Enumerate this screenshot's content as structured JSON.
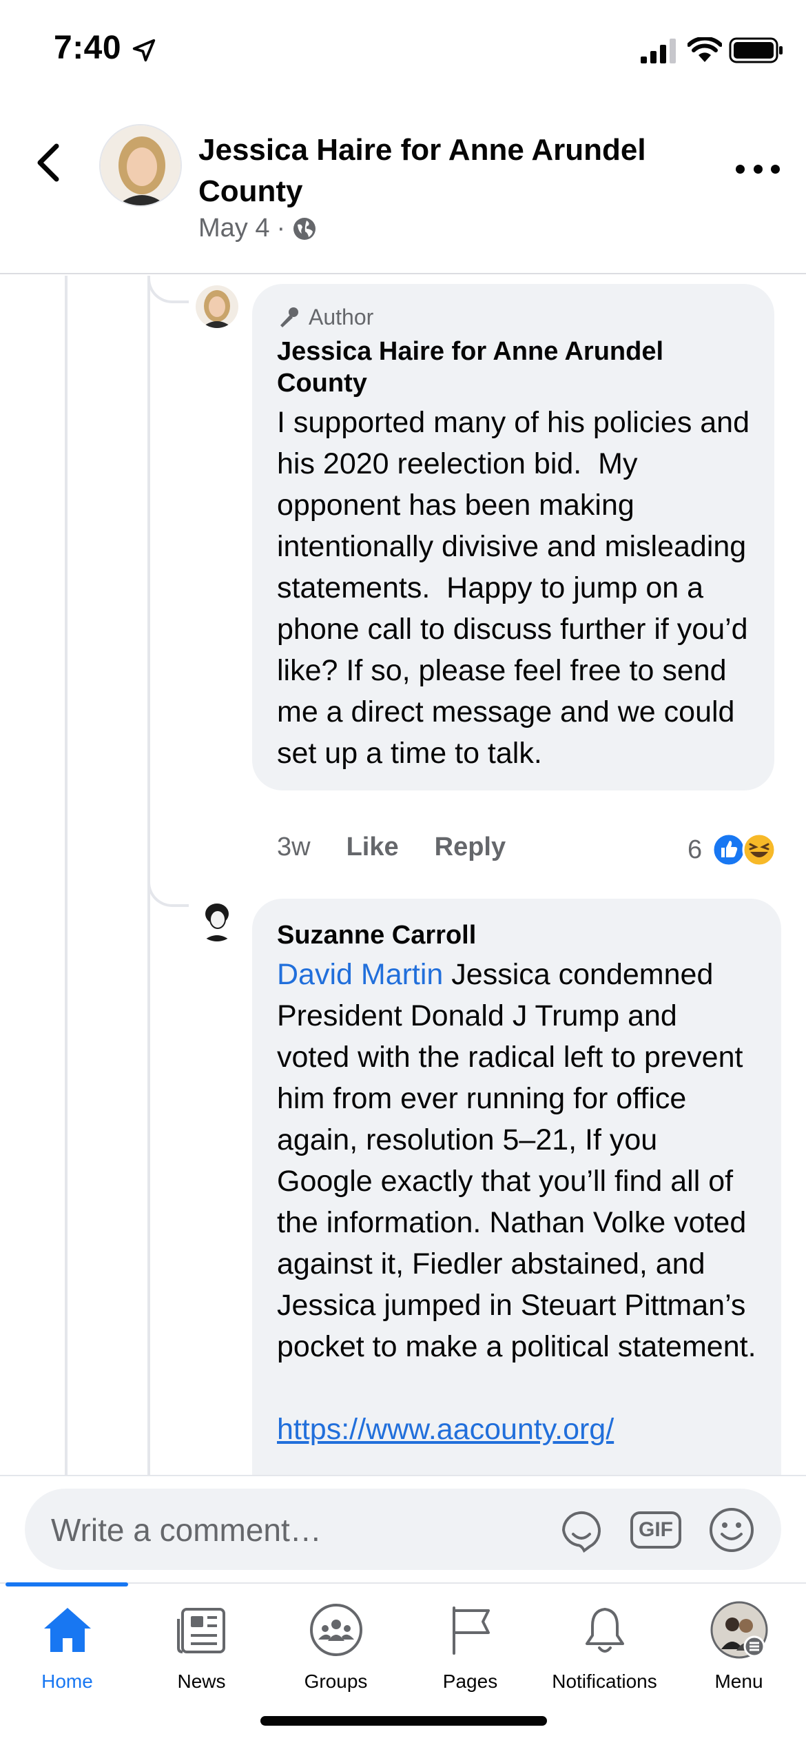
{
  "status": {
    "time": "7:40"
  },
  "header": {
    "title": "Jessica Haire for Anne Arundel County",
    "date": "May 4",
    "separator": "·"
  },
  "comments": [
    {
      "badge": "Author",
      "name": "Jessica Haire for Anne Arundel County",
      "text": "I supported many of his policies and his 2020 reelection bid.  My opponent has been making intentionally divisive and misleading statements.  Happy to jump on a phone call to discuss further if you’d like? If so, please feel free to send me a direct message and we could set up a time to talk.",
      "time": "3w",
      "like": "Like",
      "reply": "Reply",
      "reaction_count": "6"
    },
    {
      "name": "Suzanne Carroll",
      "mention": "David Martin",
      "text": " Jessica condemned President Donald J Trump and voted with the radical left to prevent him from ever running for office again, resolution 5–21, If you Google exactly that you’ll find all of the information. Nathan Volke voted against it, Fiedler abstained, and Jessica jumped in Steuart Pittman’s pocket to make a political statement.",
      "link": "https://www.aacounty.org/"
    }
  ],
  "composer": {
    "placeholder": "Write a comment…",
    "gif_label": "GIF"
  },
  "tabs": [
    {
      "label": "Home",
      "icon": "home-icon",
      "active": true
    },
    {
      "label": "News",
      "icon": "news-icon"
    },
    {
      "label": "Groups",
      "icon": "groups-icon"
    },
    {
      "label": "Pages",
      "icon": "flag-icon"
    },
    {
      "label": "Notifications",
      "icon": "bell-icon"
    },
    {
      "label": "Menu",
      "icon": "profile-menu-icon"
    }
  ],
  "colors": {
    "accent": "#1877f2",
    "link": "#216fdb",
    "bubble": "#f0f2f5",
    "muted": "#65676b"
  }
}
